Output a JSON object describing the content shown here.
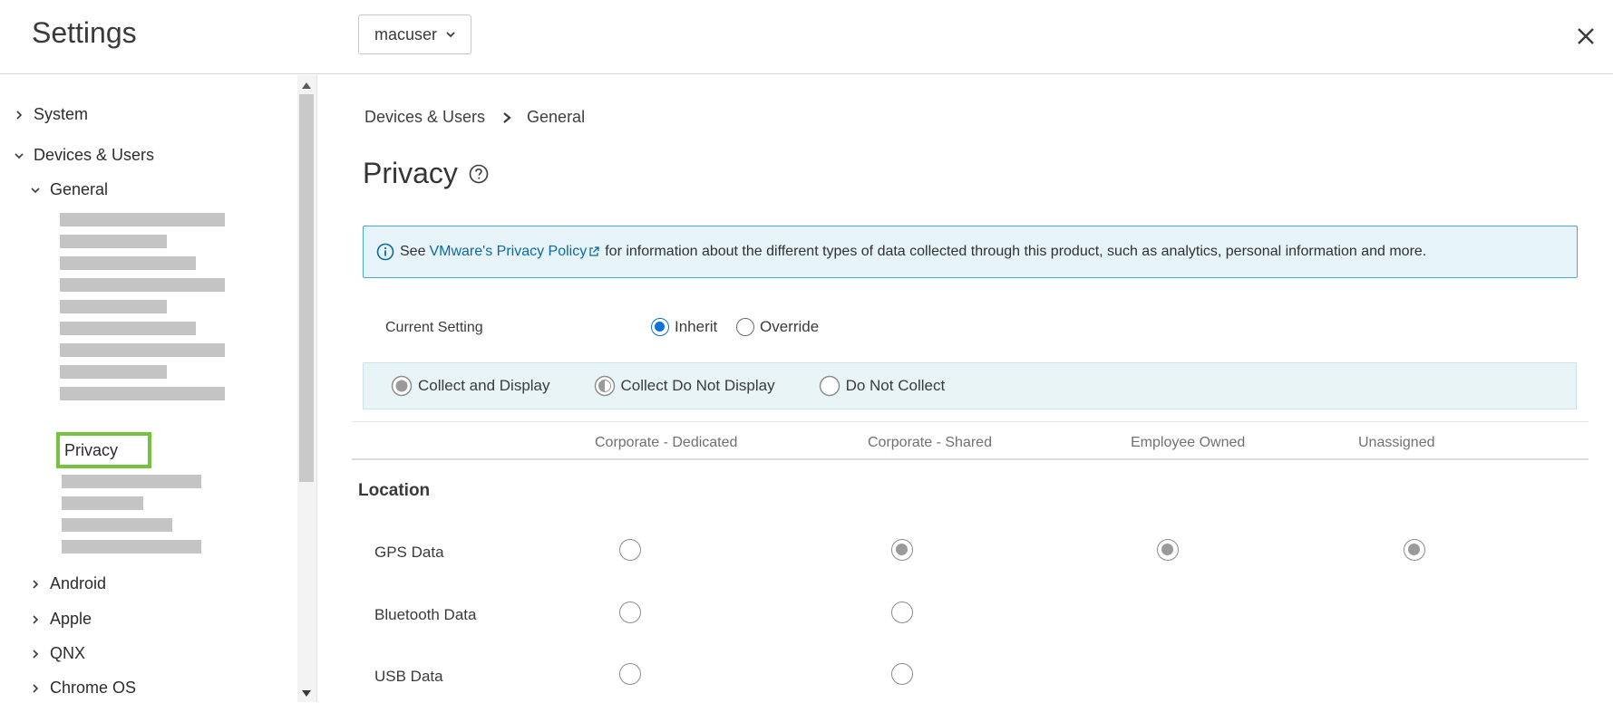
{
  "header": {
    "title": "Settings",
    "user_select": "macuser"
  },
  "sidebar": {
    "system": "System",
    "devices_users": "Devices & Users",
    "general": "General",
    "privacy": "Privacy",
    "android": "Android",
    "apple": "Apple",
    "qnx": "QNX",
    "chrome_os": "Chrome OS"
  },
  "breadcrumb": {
    "parent": "Devices & Users",
    "current": "General"
  },
  "page": {
    "title": "Privacy"
  },
  "info": {
    "prefix": "See",
    "link": "VMware's Privacy Policy",
    "suffix": "for information about the different types of data collected through this product, such as analytics, personal information and more."
  },
  "current_setting": {
    "label": "Current Setting",
    "inherit": "Inherit",
    "override": "Override",
    "selected": "Inherit"
  },
  "legend": {
    "collect_display": "Collect and Display",
    "collect_no_display": "Collect Do Not Display",
    "do_not_collect": "Do Not Collect"
  },
  "columns": [
    "Corporate - Dedicated",
    "Corporate - Shared",
    "Employee Owned",
    "Unassigned"
  ],
  "location": {
    "title": "Location",
    "rows": [
      {
        "label": "GPS Data",
        "values": [
          "Do Not Collect",
          "Collect and Display",
          "Collect and Display",
          "Collect and Display"
        ]
      },
      {
        "label": "Bluetooth Data",
        "values": [
          "Do Not Collect",
          "Do Not Collect"
        ]
      },
      {
        "label": "USB Data",
        "values": [
          "Do Not Collect",
          "Do Not Collect"
        ]
      }
    ]
  },
  "colors": {
    "accent": "#0b72d6",
    "highlight": "#74c23d",
    "info_border": "#49a9c6",
    "info_bg": "#e6f3f8",
    "link": "#0b6aa2"
  }
}
